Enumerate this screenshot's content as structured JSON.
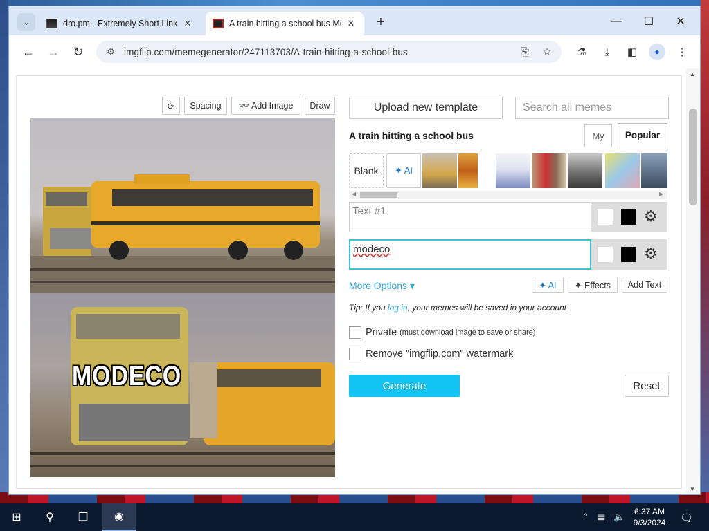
{
  "browser": {
    "tabs": [
      {
        "title": "dro.pm - Extremely Short Links",
        "close": "✕"
      },
      {
        "title": "A train hitting a school bus Meme Generator",
        "close": "✕"
      }
    ],
    "new_tab": "+",
    "url": "imgflip.com/memegenerator/247113703/A-train-hitting-a-school-bus"
  },
  "editor": {
    "tools": {
      "rotate": "⟳",
      "spacing": "Spacing",
      "add_image": "👓 Add Image",
      "draw": "Draw"
    },
    "meme_text": "MODECO"
  },
  "panel": {
    "upload_label": "Upload new template",
    "search_placeholder": "Search all memes",
    "template_title": "A train hitting a school bus",
    "tab_my": "My",
    "tab_popular": "Popular",
    "thumb_blank": "Blank",
    "thumb_ai": "✦ AI",
    "text1_placeholder": "Text #1",
    "text2_value": "modeco",
    "more_options": "More Options ▾",
    "ai_label": "✦ AI",
    "effects_label": "✦ Effects",
    "add_text_label": "Add Text",
    "tip_prefix": "Tip: If you ",
    "tip_link": "log in",
    "tip_suffix": ", your memes will be saved in your account",
    "private_label": "Private",
    "private_note": "(must download image to save or share)",
    "watermark_label": "Remove \"imgflip.com\" watermark",
    "generate_label": "Generate",
    "reset_label": "Reset"
  },
  "taskbar": {
    "time": "6:37 AM",
    "date": "9/3/2024"
  },
  "colors": {
    "accent": "#12c3f4",
    "link": "#2fa6d8",
    "active_border": "#3ac4d6"
  }
}
